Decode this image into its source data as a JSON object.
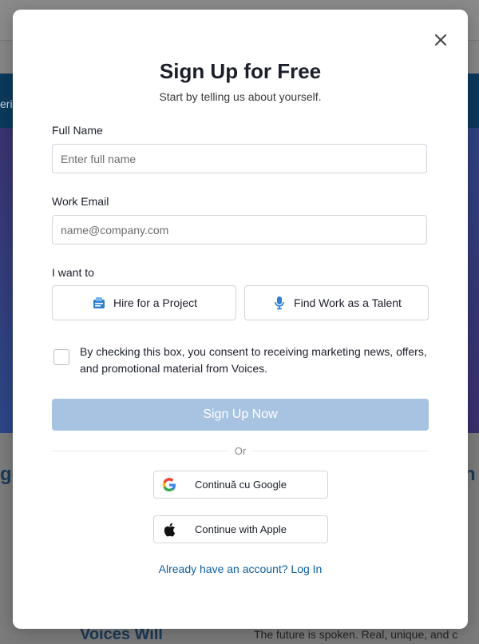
{
  "background": {
    "fragment_left": "ge",
    "fragment_right": "th",
    "fragment_side": "eri",
    "fragment_bottom_left": "Voices Will",
    "bottom_text": "The future is spoken. Real, unique, and c"
  },
  "modal": {
    "title": "Sign Up for Free",
    "subtitle": "Start by telling us about yourself.",
    "full_name": {
      "label": "Full Name",
      "placeholder": "Enter full name",
      "value": ""
    },
    "work_email": {
      "label": "Work Email",
      "placeholder": "name@company.com",
      "value": ""
    },
    "intent": {
      "label": "I want to",
      "options": [
        {
          "label": "Hire for a Project",
          "icon": "clipboard-icon"
        },
        {
          "label": "Find Work as a Talent",
          "icon": "microphone-icon"
        }
      ]
    },
    "consent_text": "By checking this box, you consent to receiving marketing news, offers, and promotional material from Voices.",
    "signup_button": "Sign Up Now",
    "or_label": "Or",
    "google_button": "Continuă cu Google",
    "apple_button": "Continue with Apple",
    "login_link": "Already have an account? Log In"
  },
  "colors": {
    "primary_disabled": "#a7c3e1",
    "link": "#0d5fa0",
    "title": "#1b1f2a",
    "brand_dark": "#0b3a5c"
  }
}
